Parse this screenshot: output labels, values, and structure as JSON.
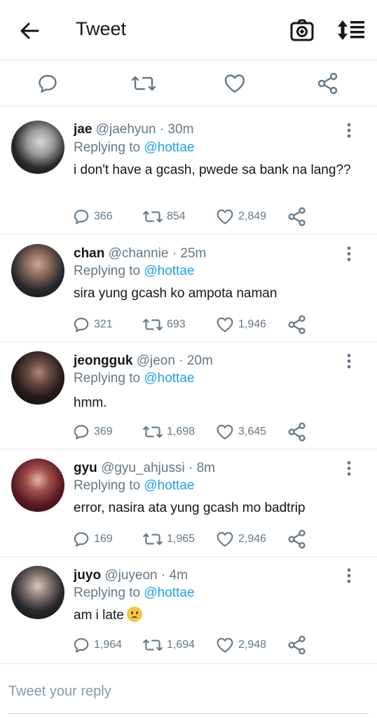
{
  "header": {
    "title": "Tweet",
    "back_icon": "arrow-left-icon",
    "camera_icon": "camera-icon",
    "sort_icon": "sort-icon"
  },
  "actions": {
    "reply_icon": "reply-icon",
    "retweet_icon": "retweet-icon",
    "like_icon": "heart-icon",
    "share_icon": "share-icon"
  },
  "tweets": [
    {
      "name": "jae",
      "handle": "@jaehyun",
      "time": "· 30m",
      "replying_prefix": "Replying to",
      "replying_to": "@hottae",
      "text": "i don't have a gcash, pwede sa bank na lang??",
      "replies": "366",
      "retweets": "854",
      "likes": "2,849"
    },
    {
      "name": "chan",
      "handle": "@channie",
      "time": "· 25m",
      "replying_prefix": "Replying to",
      "replying_to": "@hottae",
      "text": "sira yung gcash ko ampota naman",
      "replies": "321",
      "retweets": "693",
      "likes": "1,946"
    },
    {
      "name": "jeongguk",
      "handle": "@jeon",
      "time": "· 20m",
      "replying_prefix": "Replying to",
      "replying_to": "@hottae",
      "text": "hmm.",
      "replies": "369",
      "retweets": "1,698",
      "likes": "3,645"
    },
    {
      "name": "gyu",
      "handle": "@gyu_ahjussi",
      "time": "· 8m",
      "replying_prefix": "Replying to",
      "replying_to": "@hottae",
      "text": "error, nasira ata yung gcash mo badtrip",
      "replies": "169",
      "retweets": "1,965",
      "likes": "2,946"
    },
    {
      "name": "juyo",
      "handle": "@juyeon",
      "time": "· 4m",
      "replying_prefix": "Replying to",
      "replying_to": "@hottae",
      "text": "am i late",
      "emoji": "confused-face-emoji",
      "replies": "1,964",
      "retweets": "1,694",
      "likes": "2,948"
    }
  ],
  "reply_box": {
    "placeholder": "Tweet your reply"
  },
  "colors": {
    "link": "#1da1f2",
    "muted": "#657786",
    "divider": "#e1e8ed"
  }
}
